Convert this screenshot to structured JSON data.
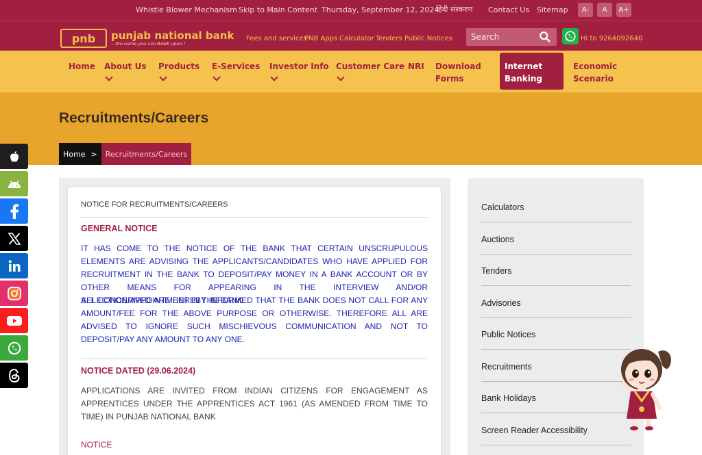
{
  "topbar": {
    "links": [
      "Whistle Blower Mechanism",
      "Skip to Main Content",
      "Thursday, September 12, 2024",
      "हिंदी संस्करण",
      "Contact Us",
      "Sitemap"
    ],
    "font_sizes": [
      "A-",
      "A",
      "A+"
    ]
  },
  "brand": {
    "logo_short": "pnb",
    "logo_name": "punjab national bank",
    "logo_tagline": "...the name you can BANK upon !",
    "quicklinks": [
      "Fees and services",
      "PNB Apps",
      "Calculator",
      "Tenders",
      "Public Notices"
    ],
    "search_placeholder": "Search",
    "whatsapp_text": "Hi to 9264092640"
  },
  "nav": {
    "items": [
      {
        "label": "Home",
        "has_dropdown": false
      },
      {
        "label": "About Us",
        "has_dropdown": true
      },
      {
        "label": "Products",
        "has_dropdown": true
      },
      {
        "label": "E-Services",
        "has_dropdown": true
      },
      {
        "label": "Investor Info",
        "has_dropdown": true
      },
      {
        "label": "Customer Care",
        "has_dropdown": true
      },
      {
        "label": "NRI",
        "has_dropdown": false
      },
      {
        "label": "Download Forms",
        "has_dropdown": false
      },
      {
        "label": "Internet Banking",
        "has_dropdown": false,
        "active": true
      },
      {
        "label": "Economic Scenario",
        "has_dropdown": false
      }
    ]
  },
  "page": {
    "title": "Recruitments/Careers",
    "breadcrumb": [
      "Home",
      "Recruitments/Careers"
    ],
    "breadcrumb_separator": ">"
  },
  "content": {
    "heading": "NOTICE FOR RECRUITMENTS/CAREERS",
    "general_notice_title": "GENERAL NOTICE",
    "general_notice_p1": "IT HAS COME TO THE NOTICE OF THE BANK THAT CERTAIN UNSCRUPULOUS ELEMENTS ARE ADVISING THE APPLICANTS/CANDIDATES WHO HAVE APPLIED FOR RECRUITMENT IN THE BANK TO DEPOSIT/PAY MONEY IN A BANK ACCOUNT OR BY OTHER MEANS FOR APPEARING IN THE INTERVIEW AND/OR SELECTION/APPOINTMENT IN THE BANK.",
    "general_notice_p2": "ALL CONCERNED ARE HEREBY INFORMED THAT THE BANK DOES NOT CALL FOR ANY AMOUNT/FEE FOR THE ABOVE PURPOSE OR OTHERWISE. THEREFORE ALL ARE ADVISED TO IGNORE SUCH MISCHIEVOUS COMMUNICATION AND NOT TO DEPOSIT/PAY ANY AMOUNT TO ANY ONE.",
    "dated_notice_title": "NOTICE DATED (29.06.2024)",
    "dated_notice_text": "APPLICATIONS ARE INVITED FROM INDIAN CITIZENS FOR ENGAGEMENT AS APPRENTICES UNDER THE APPRENTICES ACT 1961 (AS AMENDED FROM TIME TO TIME) IN PUNJAB NATIONAL BANK",
    "notice_link": "NOTICE"
  },
  "sidebar": {
    "items": [
      "Calculators",
      "Auctions",
      "Tenders",
      "Advisories",
      "Public Notices",
      "Recruitments",
      "Bank Holidays",
      "Screen Reader Accessibility"
    ]
  },
  "social": [
    {
      "icon": "apple-icon",
      "color": "#1e1e1e"
    },
    {
      "icon": "android-icon",
      "color": "#8ab33f"
    },
    {
      "icon": "facebook-icon",
      "color": "#1877f2"
    },
    {
      "icon": "x-icon",
      "color": "#000000"
    },
    {
      "icon": "linkedin-icon",
      "color": "#0a66c2"
    },
    {
      "icon": "instagram-icon",
      "color": "#e1306c"
    },
    {
      "icon": "youtube-icon",
      "color": "#ff1c1c"
    },
    {
      "icon": "whatsapp-icon",
      "color": "#3aa83a"
    },
    {
      "icon": "threads-icon",
      "color": "#000000"
    }
  ],
  "colors": {
    "brand_maroon": "#a2203f",
    "brand_gold": "#f5c34d",
    "title_band": "#e7a62b"
  }
}
